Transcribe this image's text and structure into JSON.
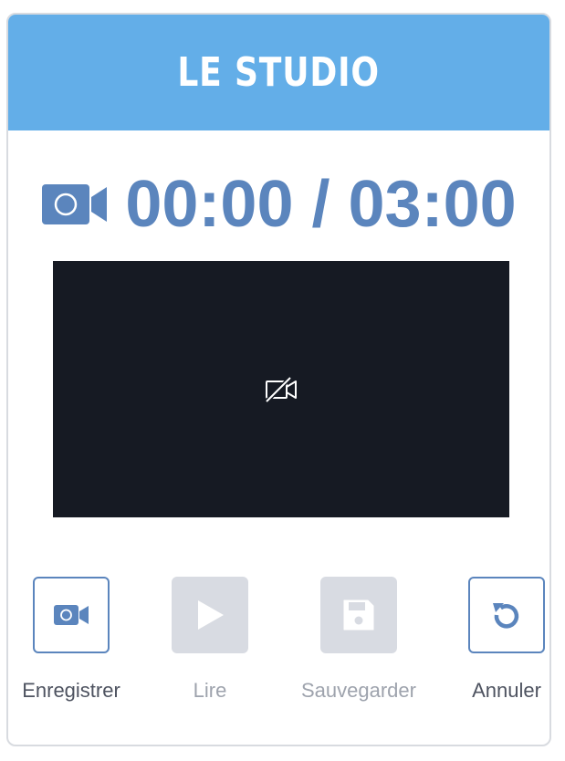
{
  "header": {
    "title": "LE STUDIO"
  },
  "timer": {
    "icon": "video-camera-icon",
    "text": "00:00 / 03:00",
    "elapsed": "00:00",
    "total": "03:00"
  },
  "preview": {
    "icon": "video-off-icon"
  },
  "controls": [
    {
      "id": "record",
      "label": "Enregistrer",
      "icon": "video-camera-icon",
      "enabled": true
    },
    {
      "id": "play",
      "label": "Lire",
      "icon": "play-icon",
      "enabled": false
    },
    {
      "id": "save",
      "label": "Sauvegarder",
      "icon": "floppy-disk-icon",
      "enabled": false
    },
    {
      "id": "cancel",
      "label": "Annuler",
      "icon": "undo-icon",
      "enabled": true
    }
  ],
  "colors": {
    "header_bg": "#63aee8",
    "accent": "#5b85bd",
    "video_bg": "#161a23",
    "disabled_bg": "#d8dbe2",
    "label_text": "#4e5360",
    "disabled_text": "#9ea3ad"
  }
}
